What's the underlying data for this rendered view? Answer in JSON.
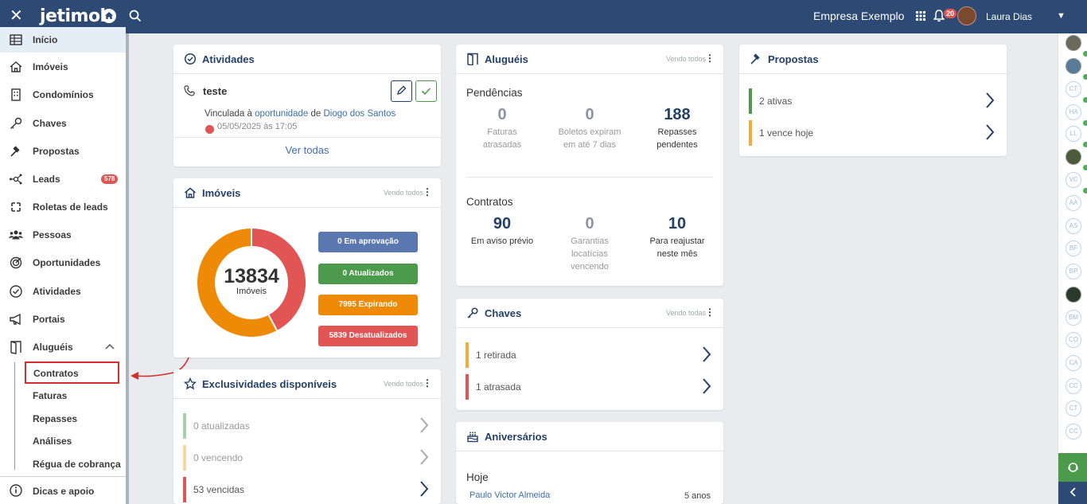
{
  "topbar": {
    "logo": "jetimob",
    "company": "Empresa Exemplo",
    "notifications": "20",
    "user": "Laura Dias"
  },
  "sidebar": {
    "items": [
      {
        "label": "Início"
      },
      {
        "label": "Imóveis"
      },
      {
        "label": "Condomínios"
      },
      {
        "label": "Chaves"
      },
      {
        "label": "Propostas"
      },
      {
        "label": "Leads",
        "badge": "578"
      },
      {
        "label": "Roletas de leads"
      },
      {
        "label": "Pessoas"
      },
      {
        "label": "Oportunidades"
      },
      {
        "label": "Atividades"
      },
      {
        "label": "Portais"
      },
      {
        "label": "Aluguéis"
      }
    ],
    "sub": [
      "Contratos",
      "Faturas",
      "Repasses",
      "Análises",
      "Régua de cobrança"
    ],
    "bottom": "Dicas e apoio"
  },
  "atividades": {
    "title": "Atividades",
    "item_title": "teste",
    "desc_prefix": "Vinculada à",
    "desc_link1": "oportunidade",
    "desc_mid": "de",
    "desc_link2": "Diogo dos Santos",
    "date": "05/05/2025 às 17:05",
    "link": "Ver todas"
  },
  "imoveis": {
    "title": "Imóveis",
    "vendo": "Vendo todos",
    "total": "13834",
    "total_label": "Imóveis",
    "pills": [
      "0 Em aprovação",
      "0 Atualizados",
      "7995 Expirando",
      "5839 Desatualizados"
    ],
    "colors": [
      "#5b77b0",
      "#4c9a4c",
      "#ee8a06",
      "#e25555"
    ]
  },
  "chart_data": {
    "type": "pie",
    "categories": [
      "Em aprovação",
      "Atualizados",
      "Expirando",
      "Desatualizados"
    ],
    "values": [
      0,
      0,
      7995,
      5839
    ]
  },
  "exclusividades": {
    "title": "Exclusividades disponíveis",
    "vendo": "Vendo todos",
    "rows": [
      "0 atualizadas",
      "0 vencendo",
      "53 vencidas"
    ]
  },
  "alugueis": {
    "title": "Aluguéis",
    "vendo": "Vendo todos",
    "pendencias": "Pendências",
    "pend_stats": [
      {
        "n": "0",
        "d1": "Faturas",
        "d2": "atrasadas"
      },
      {
        "n": "0",
        "d1": "Boletos expiram",
        "d2": "em até 7 dias"
      },
      {
        "n": "188",
        "d1": "Repasses",
        "d2": "pendentes"
      }
    ],
    "contratos": "Contratos",
    "cont_stats": [
      {
        "n": "90",
        "d1": "Em aviso prévio",
        "d2": "",
        "d3": ""
      },
      {
        "n": "0",
        "d1": "Garantias",
        "d2": "locatícias",
        "d3": "vencendo"
      },
      {
        "n": "10",
        "d1": "Para reajustar",
        "d2": "neste mês",
        "d3": ""
      }
    ]
  },
  "chaves": {
    "title": "Chaves",
    "vendo": "Vendo todas",
    "rows": [
      "1 retirada",
      "1 atrasada"
    ]
  },
  "aniversarios": {
    "title": "Aniversários",
    "hoje": "Hoje",
    "person": "Paulo Victor Almeida",
    "years": "5 anos"
  },
  "propostas": {
    "title": "Propostas",
    "rows": [
      "2 ativas",
      "1 vence hoje"
    ]
  },
  "rail": {
    "initials": [
      "CT",
      "HA",
      "LL",
      "VC",
      "AA",
      "AS",
      "BF",
      "BP",
      "BM",
      "CO",
      "CA",
      "CC",
      "CT",
      "CC"
    ]
  }
}
